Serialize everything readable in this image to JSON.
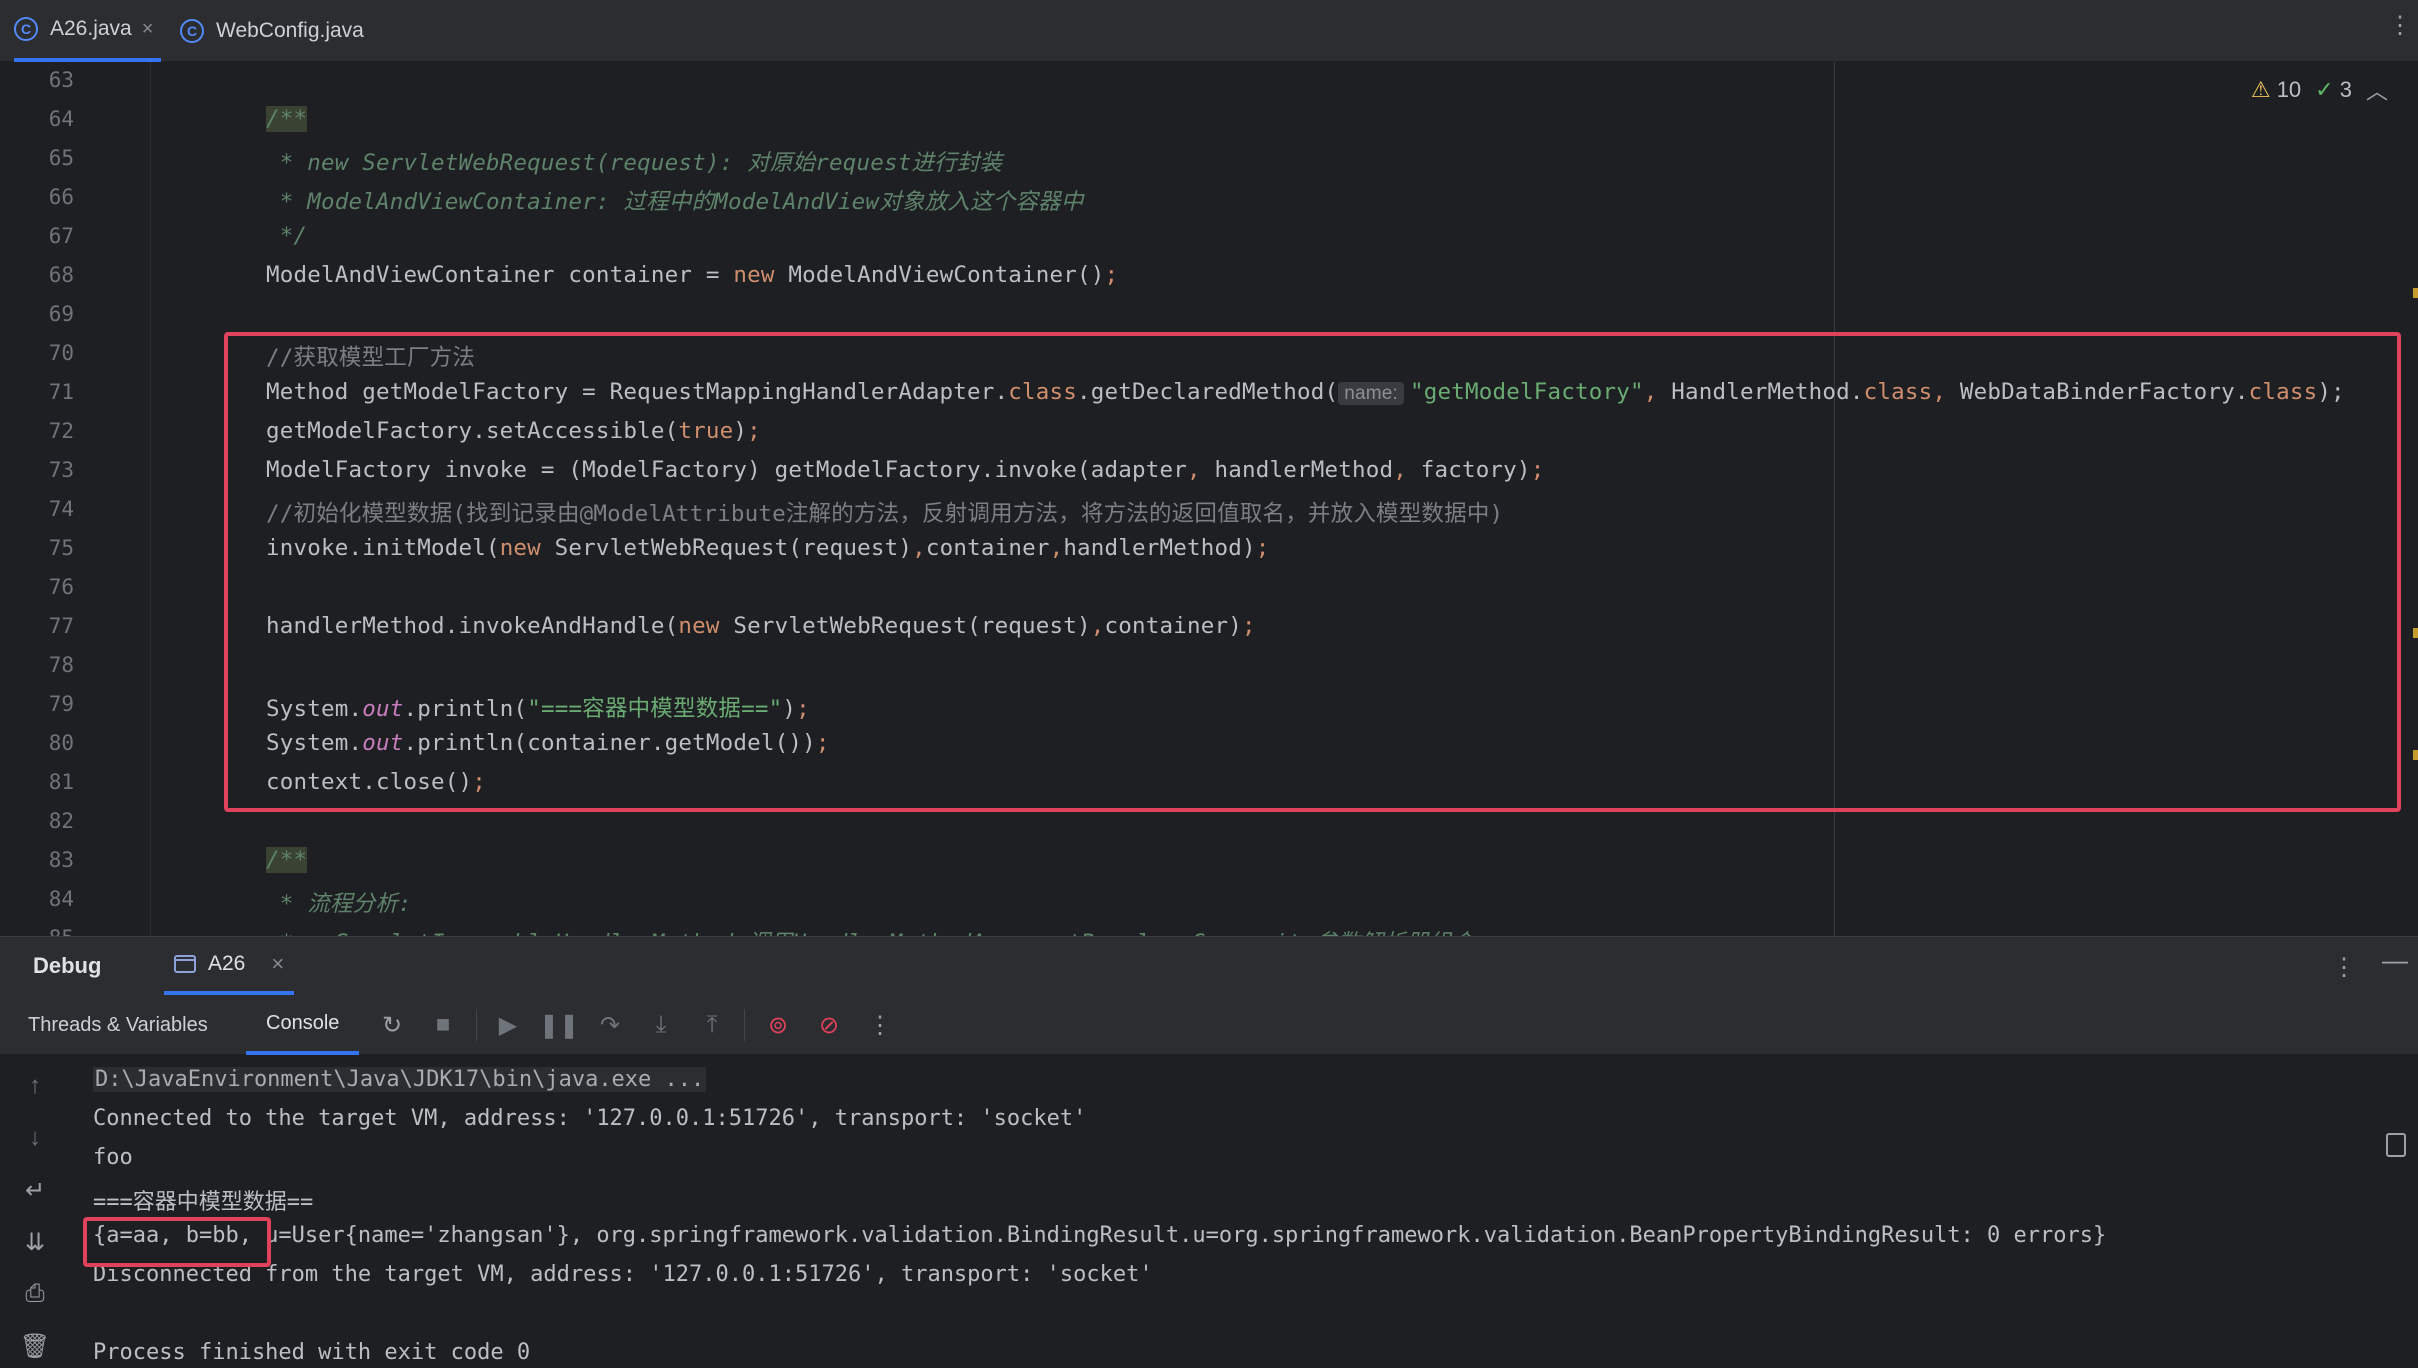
{
  "tabs": [
    {
      "label": "A26.java",
      "icon": "class-icon",
      "active": true
    },
    {
      "label": "WebConfig.java",
      "icon": "class-icon",
      "active": false
    }
  ],
  "inspections": {
    "warnings": "10",
    "weak_warnings": "3"
  },
  "line_numbers": [
    "63",
    "64",
    "65",
    "66",
    "67",
    "68",
    "69",
    "70",
    "71",
    "72",
    "73",
    "74",
    "75",
    "76",
    "77",
    "78",
    "79",
    "80",
    "81",
    "82",
    "83",
    "84",
    "85"
  ],
  "code": {
    "l64": "/**",
    "l65": " * new ServletWebRequest(request): 对原始request进行封装",
    "l66": " * ModelAndViewContainer: 过程中的ModelAndView对象放入这个容器中",
    "l67": " */",
    "l68": [
      "ModelAndViewContainer container = ",
      "new",
      " ModelAndViewContainer()",
      ";"
    ],
    "l70": "//获取模型工厂方法",
    "l71": [
      "Method getModelFactory = RequestMappingHandlerAdapter.",
      "class",
      ".getDeclaredMethod(",
      "name:",
      "\"getModelFactory\"",
      ", ",
      "HandlerMethod.",
      "class",
      ", ",
      "WebDataBinderFactory.",
      "class",
      ");"
    ],
    "l72": [
      "getModelFactory.setAccessible(",
      "true",
      ")",
      ";"
    ],
    "l73": [
      "ModelFactory invoke = (ModelFactory) getModelFactory.invoke(adapter",
      ", ",
      "handlerMethod",
      ", ",
      "factory)",
      ";"
    ],
    "l74": "//初始化模型数据(找到记录由@ModelAttribute注解的方法，反射调用方法，将方法的返回值取名，并放入模型数据中)",
    "l75": [
      "invoke.initModel(",
      "new",
      " ServletWebRequest(request)",
      ",",
      "container",
      ",",
      "handlerMethod)",
      ";"
    ],
    "l77": [
      "handlerMethod.invokeAndHandle(",
      "new",
      " ServletWebRequest(request)",
      ",",
      "container)",
      ";"
    ],
    "l79": [
      "System.",
      "out",
      ".println(",
      "\"===容器中模型数据==\"",
      ")",
      ";"
    ],
    "l80": [
      "System.",
      "out",
      ".println(container.getModel())",
      ";"
    ],
    "l81": [
      "context.close()",
      ";"
    ],
    "l83": "/**",
    "l84": " * 流程分析:",
    "l85": " *   ServletInvocableHandlerMethod 调用HandlerMethodArgumentResolverComposite参数解析器组合"
  },
  "debug": {
    "title": "Debug",
    "session_tab": "A26",
    "subtabs": [
      "Threads & Variables",
      "Console"
    ]
  },
  "console": {
    "cmd": "D:\\JavaEnvironment\\Java\\JDK17\\bin\\java.exe ...",
    "connected": "Connected to the target VM, address: '127.0.0.1:51726', transport: 'socket'",
    "foo": "foo",
    "header": "===容器中模型数据==",
    "result": "{a=aa, b=bb, u=User{name='zhangsan'}, org.springframework.validation.BindingResult.u=org.springframework.validation.BeanPropertyBindingResult: 0 errors}",
    "disconnected": "Disconnected from the target VM, address: '127.0.0.1:51726', transport: 'socket'",
    "exit": "Process finished with exit code 0"
  },
  "colors": {
    "accent": "#3574f0",
    "highlight": "#e0415b",
    "keyword": "#cf8e6d",
    "string": "#6aab73",
    "doc_comment": "#5f826b"
  }
}
